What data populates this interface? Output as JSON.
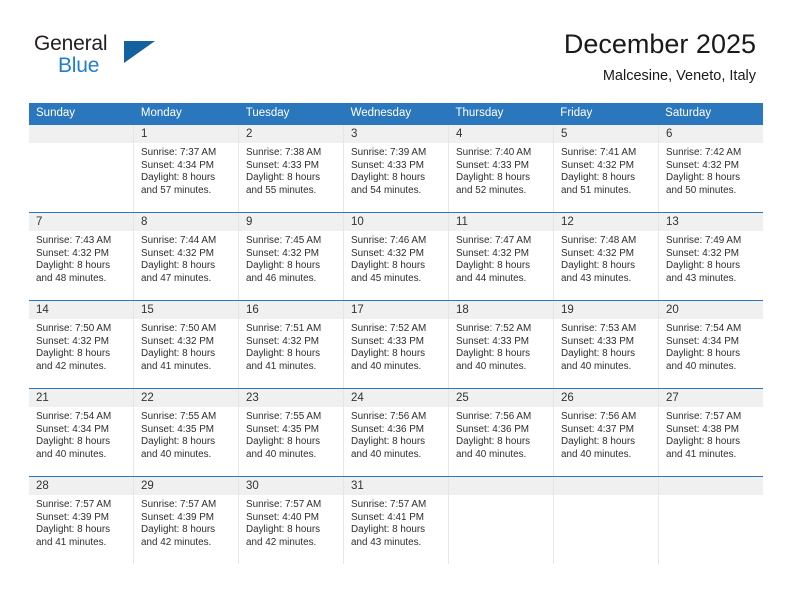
{
  "brand": {
    "name_top": "General",
    "name_bottom": "Blue",
    "triangle_color": "#14619e",
    "blue_text_color": "#1f7fd0"
  },
  "header": {
    "title": "December 2025",
    "subtitle": "Malcesine, Veneto, Italy",
    "accent_color": "#2b77bd",
    "daynum_band_color": "#f0f0f0"
  },
  "weekdays": [
    "Sunday",
    "Monday",
    "Tuesday",
    "Wednesday",
    "Thursday",
    "Friday",
    "Saturday"
  ],
  "weeks": [
    [
      {
        "day": "",
        "sunrise": "",
        "sunset": "",
        "daylight1": "",
        "daylight2": ""
      },
      {
        "day": "1",
        "sunrise": "Sunrise: 7:37 AM",
        "sunset": "Sunset: 4:34 PM",
        "daylight1": "Daylight: 8 hours",
        "daylight2": "and 57 minutes."
      },
      {
        "day": "2",
        "sunrise": "Sunrise: 7:38 AM",
        "sunset": "Sunset: 4:33 PM",
        "daylight1": "Daylight: 8 hours",
        "daylight2": "and 55 minutes."
      },
      {
        "day": "3",
        "sunrise": "Sunrise: 7:39 AM",
        "sunset": "Sunset: 4:33 PM",
        "daylight1": "Daylight: 8 hours",
        "daylight2": "and 54 minutes."
      },
      {
        "day": "4",
        "sunrise": "Sunrise: 7:40 AM",
        "sunset": "Sunset: 4:33 PM",
        "daylight1": "Daylight: 8 hours",
        "daylight2": "and 52 minutes."
      },
      {
        "day": "5",
        "sunrise": "Sunrise: 7:41 AM",
        "sunset": "Sunset: 4:32 PM",
        "daylight1": "Daylight: 8 hours",
        "daylight2": "and 51 minutes."
      },
      {
        "day": "6",
        "sunrise": "Sunrise: 7:42 AM",
        "sunset": "Sunset: 4:32 PM",
        "daylight1": "Daylight: 8 hours",
        "daylight2": "and 50 minutes."
      }
    ],
    [
      {
        "day": "7",
        "sunrise": "Sunrise: 7:43 AM",
        "sunset": "Sunset: 4:32 PM",
        "daylight1": "Daylight: 8 hours",
        "daylight2": "and 48 minutes."
      },
      {
        "day": "8",
        "sunrise": "Sunrise: 7:44 AM",
        "sunset": "Sunset: 4:32 PM",
        "daylight1": "Daylight: 8 hours",
        "daylight2": "and 47 minutes."
      },
      {
        "day": "9",
        "sunrise": "Sunrise: 7:45 AM",
        "sunset": "Sunset: 4:32 PM",
        "daylight1": "Daylight: 8 hours",
        "daylight2": "and 46 minutes."
      },
      {
        "day": "10",
        "sunrise": "Sunrise: 7:46 AM",
        "sunset": "Sunset: 4:32 PM",
        "daylight1": "Daylight: 8 hours",
        "daylight2": "and 45 minutes."
      },
      {
        "day": "11",
        "sunrise": "Sunrise: 7:47 AM",
        "sunset": "Sunset: 4:32 PM",
        "daylight1": "Daylight: 8 hours",
        "daylight2": "and 44 minutes."
      },
      {
        "day": "12",
        "sunrise": "Sunrise: 7:48 AM",
        "sunset": "Sunset: 4:32 PM",
        "daylight1": "Daylight: 8 hours",
        "daylight2": "and 43 minutes."
      },
      {
        "day": "13",
        "sunrise": "Sunrise: 7:49 AM",
        "sunset": "Sunset: 4:32 PM",
        "daylight1": "Daylight: 8 hours",
        "daylight2": "and 43 minutes."
      }
    ],
    [
      {
        "day": "14",
        "sunrise": "Sunrise: 7:50 AM",
        "sunset": "Sunset: 4:32 PM",
        "daylight1": "Daylight: 8 hours",
        "daylight2": "and 42 minutes."
      },
      {
        "day": "15",
        "sunrise": "Sunrise: 7:50 AM",
        "sunset": "Sunset: 4:32 PM",
        "daylight1": "Daylight: 8 hours",
        "daylight2": "and 41 minutes."
      },
      {
        "day": "16",
        "sunrise": "Sunrise: 7:51 AM",
        "sunset": "Sunset: 4:32 PM",
        "daylight1": "Daylight: 8 hours",
        "daylight2": "and 41 minutes."
      },
      {
        "day": "17",
        "sunrise": "Sunrise: 7:52 AM",
        "sunset": "Sunset: 4:33 PM",
        "daylight1": "Daylight: 8 hours",
        "daylight2": "and 40 minutes."
      },
      {
        "day": "18",
        "sunrise": "Sunrise: 7:52 AM",
        "sunset": "Sunset: 4:33 PM",
        "daylight1": "Daylight: 8 hours",
        "daylight2": "and 40 minutes."
      },
      {
        "day": "19",
        "sunrise": "Sunrise: 7:53 AM",
        "sunset": "Sunset: 4:33 PM",
        "daylight1": "Daylight: 8 hours",
        "daylight2": "and 40 minutes."
      },
      {
        "day": "20",
        "sunrise": "Sunrise: 7:54 AM",
        "sunset": "Sunset: 4:34 PM",
        "daylight1": "Daylight: 8 hours",
        "daylight2": "and 40 minutes."
      }
    ],
    [
      {
        "day": "21",
        "sunrise": "Sunrise: 7:54 AM",
        "sunset": "Sunset: 4:34 PM",
        "daylight1": "Daylight: 8 hours",
        "daylight2": "and 40 minutes."
      },
      {
        "day": "22",
        "sunrise": "Sunrise: 7:55 AM",
        "sunset": "Sunset: 4:35 PM",
        "daylight1": "Daylight: 8 hours",
        "daylight2": "and 40 minutes."
      },
      {
        "day": "23",
        "sunrise": "Sunrise: 7:55 AM",
        "sunset": "Sunset: 4:35 PM",
        "daylight1": "Daylight: 8 hours",
        "daylight2": "and 40 minutes."
      },
      {
        "day": "24",
        "sunrise": "Sunrise: 7:56 AM",
        "sunset": "Sunset: 4:36 PM",
        "daylight1": "Daylight: 8 hours",
        "daylight2": "and 40 minutes."
      },
      {
        "day": "25",
        "sunrise": "Sunrise: 7:56 AM",
        "sunset": "Sunset: 4:36 PM",
        "daylight1": "Daylight: 8 hours",
        "daylight2": "and 40 minutes."
      },
      {
        "day": "26",
        "sunrise": "Sunrise: 7:56 AM",
        "sunset": "Sunset: 4:37 PM",
        "daylight1": "Daylight: 8 hours",
        "daylight2": "and 40 minutes."
      },
      {
        "day": "27",
        "sunrise": "Sunrise: 7:57 AM",
        "sunset": "Sunset: 4:38 PM",
        "daylight1": "Daylight: 8 hours",
        "daylight2": "and 41 minutes."
      }
    ],
    [
      {
        "day": "28",
        "sunrise": "Sunrise: 7:57 AM",
        "sunset": "Sunset: 4:39 PM",
        "daylight1": "Daylight: 8 hours",
        "daylight2": "and 41 minutes."
      },
      {
        "day": "29",
        "sunrise": "Sunrise: 7:57 AM",
        "sunset": "Sunset: 4:39 PM",
        "daylight1": "Daylight: 8 hours",
        "daylight2": "and 42 minutes."
      },
      {
        "day": "30",
        "sunrise": "Sunrise: 7:57 AM",
        "sunset": "Sunset: 4:40 PM",
        "daylight1": "Daylight: 8 hours",
        "daylight2": "and 42 minutes."
      },
      {
        "day": "31",
        "sunrise": "Sunrise: 7:57 AM",
        "sunset": "Sunset: 4:41 PM",
        "daylight1": "Daylight: 8 hours",
        "daylight2": "and 43 minutes."
      },
      {
        "day": "",
        "sunrise": "",
        "sunset": "",
        "daylight1": "",
        "daylight2": ""
      },
      {
        "day": "",
        "sunrise": "",
        "sunset": "",
        "daylight1": "",
        "daylight2": ""
      },
      {
        "day": "",
        "sunrise": "",
        "sunset": "",
        "daylight1": "",
        "daylight2": ""
      }
    ]
  ]
}
